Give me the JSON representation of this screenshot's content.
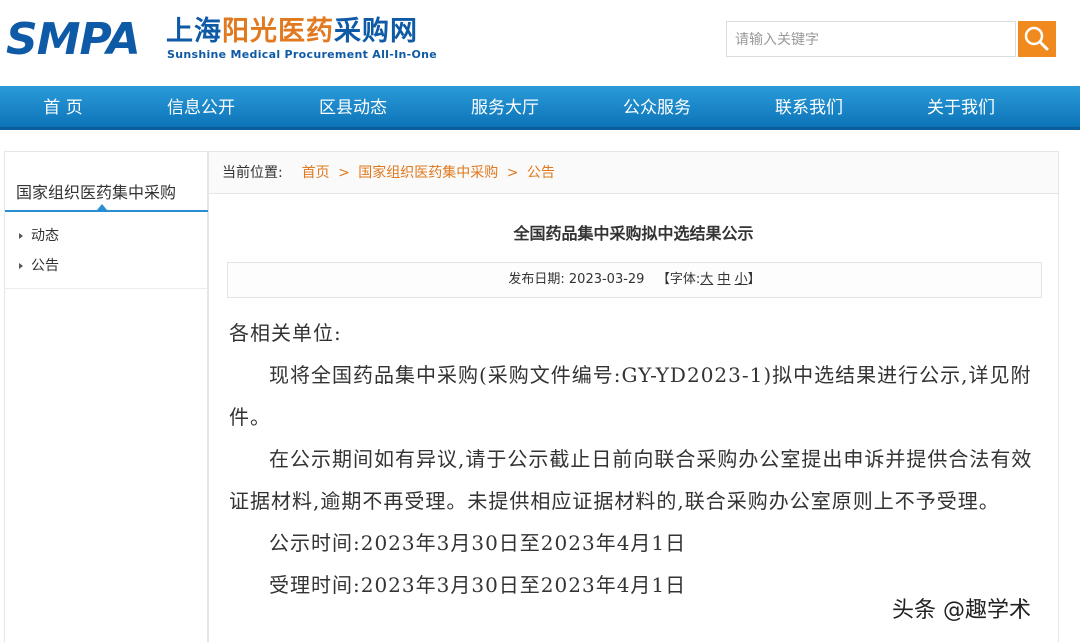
{
  "header": {
    "logo_abbr": "SMPA",
    "logo_cn_a": "上海",
    "logo_cn_b": "阳光医药",
    "logo_cn_c": "采购网",
    "logo_en": "Sunshine Medical Procurement All-In-One",
    "search_placeholder": "请输入关键字",
    "search_icon": "magnifier-icon",
    "accent_color": "#f08a1e",
    "brand_color": "#0f5aa6"
  },
  "nav": {
    "items": [
      "首 页",
      "信息公开",
      "区县动态",
      "服务大厅",
      "公众服务",
      "联系我们",
      "关于我们"
    ]
  },
  "sidebar": {
    "title": "国家组织医药集中采购",
    "items": [
      "动态",
      "公告"
    ]
  },
  "breadcrumb": {
    "label": "当前位置:",
    "links": [
      "首页",
      "国家组织医药集中采购",
      "公告"
    ],
    "separator": ">"
  },
  "article": {
    "title": "全国药品集中采购拟中选结果公示",
    "date_label": "发布日期:",
    "date": "2023-03-29",
    "font_label": "【字体:",
    "font_sizes": [
      "大",
      "中",
      "小"
    ],
    "font_close": "】",
    "salutation": "各相关单位:",
    "para1": "现将全国药品集中采购(采购文件编号:GY-YD2023-1)拟中选结果进行公示,详见附件。",
    "para2": "在公示期间如有异议,请于公示截止日前向联合采购办公室提出申诉并提供合法有效证据材料,逾期不再受理。未提供相应证据材料的,联合采购办公室原则上不予受理。",
    "notice_period": "公示时间:2023年3月30日至2023年4月1日",
    "accept_period": "受理时间:2023年3月30日至2023年4月1日"
  },
  "watermark": "头条 @趣学术"
}
